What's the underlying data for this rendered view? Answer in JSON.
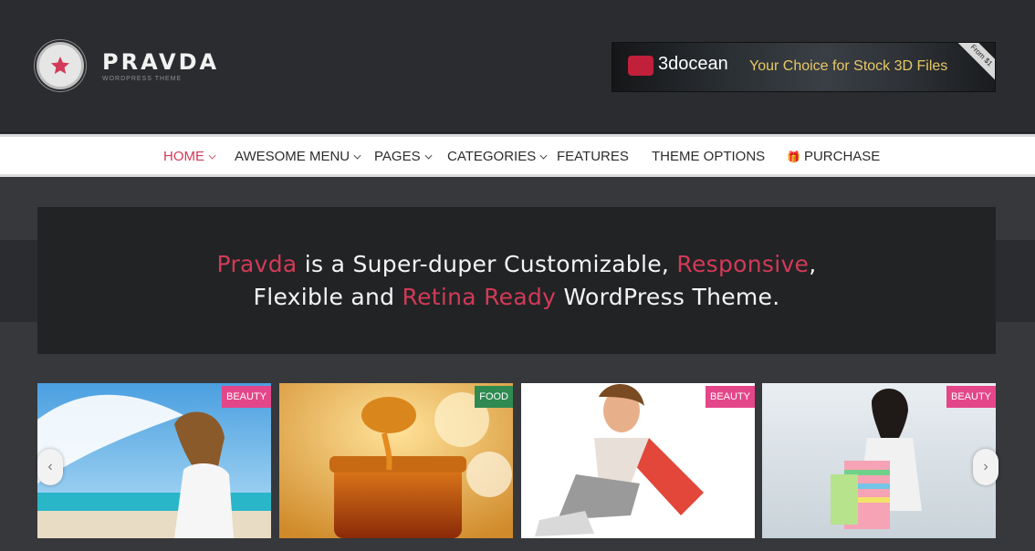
{
  "brand": {
    "title": "PRAVDA",
    "subtitle": "WORDPRESS THEME"
  },
  "ad": {
    "brand": "3docean",
    "tagline": "Your Choice for Stock 3D Files",
    "ribbon": "From $1"
  },
  "nav": [
    {
      "label": "HOME",
      "caret": true,
      "active": true
    },
    {
      "label": "AWESOME MENU",
      "caret": true
    },
    {
      "label": "PAGES",
      "caret": true
    },
    {
      "label": "CATEGORIES",
      "caret": true
    },
    {
      "label": "FEATURES",
      "caret": false
    },
    {
      "label": "THEME OPTIONS",
      "caret": false
    },
    {
      "label": "PURCHASE",
      "caret": false,
      "icon": "gift-icon"
    }
  ],
  "hero": {
    "line1": {
      "a": "Pravda",
      "b": " is a Super-duper Customizable, ",
      "c": "Responsive",
      "d": ","
    },
    "line2": {
      "a": "Flexible and ",
      "b": "Retina Ready",
      "c": " WordPress Theme."
    }
  },
  "cards": [
    {
      "category": "BEAUTY",
      "badge_color": "#e4468a"
    },
    {
      "category": "FOOD",
      "badge_color": "#2f8a52"
    },
    {
      "category": "BEAUTY",
      "badge_color": "#e4468a"
    },
    {
      "category": "BEAUTY",
      "badge_color": "#e4468a"
    }
  ],
  "carousel": {
    "prev_icon": "chevron-left-icon",
    "next_icon": "chevron-right-icon"
  },
  "colors": {
    "accent": "#d23a57",
    "beauty": "#e4468a",
    "food": "#2f8a52"
  }
}
